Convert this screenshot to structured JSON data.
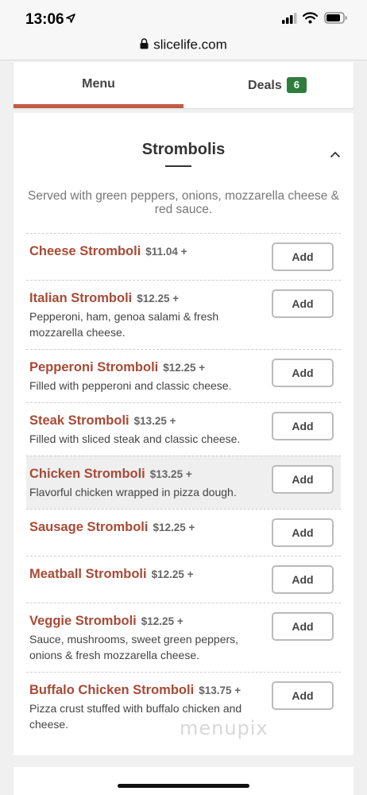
{
  "status_bar": {
    "time": "13:06"
  },
  "browser": {
    "url": "slicelife.com"
  },
  "tabs": [
    {
      "label": "Menu",
      "active": true
    },
    {
      "label": "Deals",
      "badge": "6",
      "active": false
    }
  ],
  "section": {
    "title": "Strombolis",
    "description": "Served with green peppers, onions, mozzarella cheese & red sauce."
  },
  "add_label": "Add",
  "items": [
    {
      "name": "Cheese Stromboli",
      "price": "$11.04 +",
      "description": ""
    },
    {
      "name": "Italian Stromboli",
      "price": "$12.25 +",
      "description": "Pepperoni, ham, genoa salami & fresh mozzarella cheese."
    },
    {
      "name": "Pepperoni Stromboli",
      "price": "$12.25 +",
      "description": "Filled with pepperoni and classic cheese."
    },
    {
      "name": "Steak Stromboli",
      "price": "$13.25 +",
      "description": "Filled with sliced steak and classic cheese."
    },
    {
      "name": "Chicken Stromboli",
      "price": "$13.25 +",
      "description": "Flavorful chicken wrapped in pizza dough.",
      "highlighted": true
    },
    {
      "name": "Sausage Stromboli",
      "price": "$12.25 +",
      "description": ""
    },
    {
      "name": "Meatball Stromboli",
      "price": "$12.25 +",
      "description": ""
    },
    {
      "name": "Veggie Stromboli",
      "price": "$12.25 +",
      "description": "Sauce, mushrooms, sweet green peppers, onions & fresh mozzarella cheese."
    },
    {
      "name": "Buffalo Chicken Stromboli",
      "price": "$13.75 +",
      "description": "Pizza crust stuffed with buffalo chicken and cheese."
    }
  ],
  "watermark": "menupix",
  "colors": {
    "accent": "#c25a42",
    "item_name": "#a84a36",
    "badge": "#2f7d3c"
  },
  "icons": [
    "location-arrow-icon",
    "signal-icon",
    "wifi-icon",
    "battery-icon",
    "lock-icon",
    "chevron-up-icon"
  ]
}
